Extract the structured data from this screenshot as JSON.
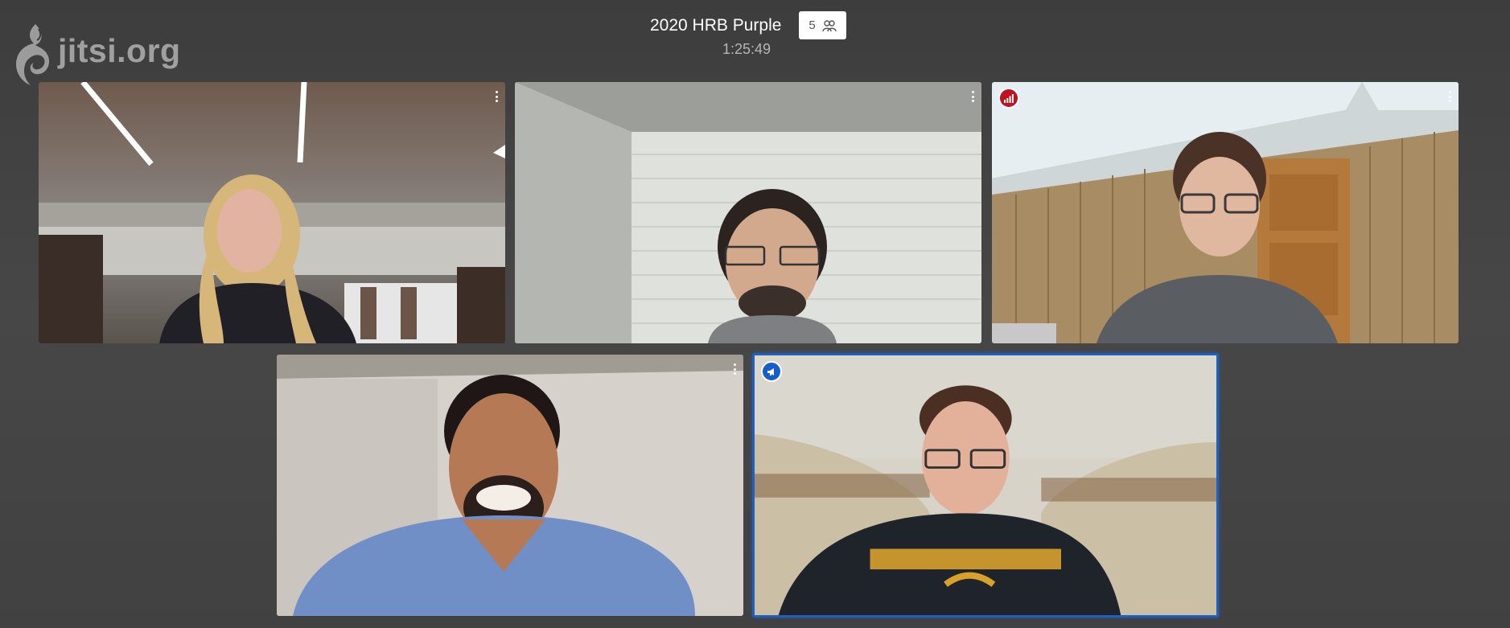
{
  "app": {
    "brand": "jitsi.org",
    "logo_icon": "jitsi-logo-icon"
  },
  "conference": {
    "title": "2020 HRB Purple",
    "participant_count": "5",
    "participants_icon": "participants-icon",
    "duration": "1:25:49"
  },
  "tiles": [
    {
      "position": 1,
      "menu_icon": "more-vertical-icon",
      "indicator": null
    },
    {
      "position": 2,
      "menu_icon": "more-vertical-icon",
      "indicator": null
    },
    {
      "position": 3,
      "menu_icon": "more-vertical-icon",
      "indicator": "connection-status-icon",
      "indicator_color": "#c1121f"
    },
    {
      "position": 4,
      "menu_icon": "more-vertical-icon",
      "indicator": null
    },
    {
      "position": 5,
      "menu_icon": null,
      "indicator": "dominant-speaker-icon",
      "indicator_color": "#165ecc",
      "active": true
    }
  ],
  "colors": {
    "background": "#404040",
    "active_border": "#1f5fbf"
  }
}
